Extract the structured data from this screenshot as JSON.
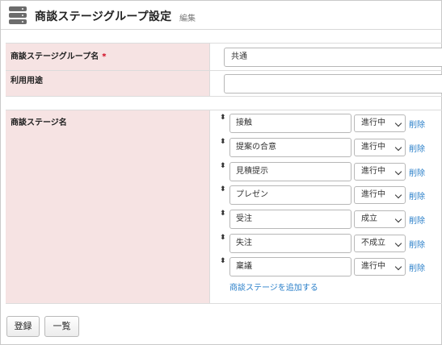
{
  "header": {
    "title": "商談ステージグループ設定",
    "subtitle": "編集"
  },
  "form": {
    "group_name": {
      "label": "商談ステージグループ名",
      "required_mark": "*",
      "value": "共通"
    },
    "usage": {
      "label": "利用用途",
      "value": ""
    },
    "stages": {
      "label": "商談ステージ名",
      "handle_glyph": "⬍",
      "delete_label": "削除",
      "add_label": "商談ステージを追加する",
      "items": [
        {
          "name": "接触",
          "status": "進行中"
        },
        {
          "name": "提案の合意",
          "status": "進行中"
        },
        {
          "name": "見積提示",
          "status": "進行中"
        },
        {
          "name": "プレゼン",
          "status": "進行中"
        },
        {
          "name": "受注",
          "status": "成立"
        },
        {
          "name": "失注",
          "status": "不成立"
        },
        {
          "name": "稟議",
          "status": "進行中"
        }
      ]
    }
  },
  "footer": {
    "register_label": "登録",
    "list_label": "一覧"
  }
}
